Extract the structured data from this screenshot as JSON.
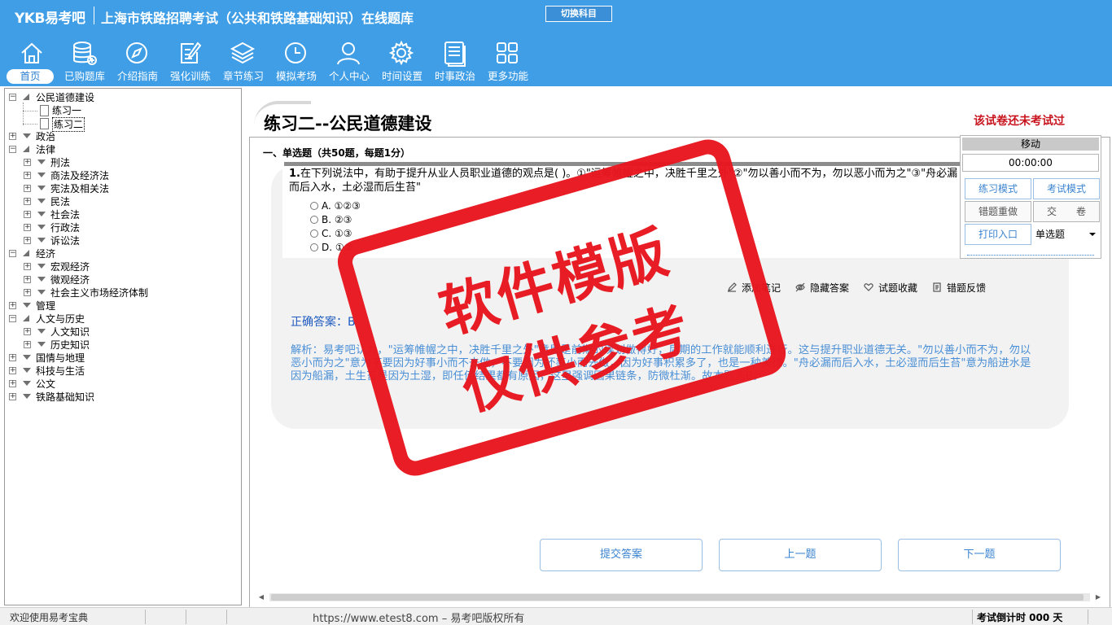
{
  "header": {
    "brand": "YKB易考吧",
    "title": "上海市铁路招聘考试（公共和铁路基础知识）在线题库",
    "switch_subject": "切换科目",
    "nav": [
      {
        "label": "首页",
        "icon": "home-icon"
      },
      {
        "label": "已购题库",
        "icon": "database-icon"
      },
      {
        "label": "介绍指南",
        "icon": "compass-icon"
      },
      {
        "label": "强化训练",
        "icon": "edit-icon"
      },
      {
        "label": "章节练习",
        "icon": "layers-icon"
      },
      {
        "label": "模拟考场",
        "icon": "clock-icon"
      },
      {
        "label": "个人中心",
        "icon": "user-icon"
      },
      {
        "label": "时间设置",
        "icon": "gear-icon"
      },
      {
        "label": "时事政治",
        "icon": "news-icon"
      },
      {
        "label": "更多功能",
        "icon": "grid-icon"
      }
    ]
  },
  "tree": [
    {
      "label": "公民道德建设",
      "level": 0,
      "state": "expanded"
    },
    {
      "label": "练习一",
      "level": 1,
      "state": "leaf"
    },
    {
      "label": "练习二",
      "level": 1,
      "state": "leaf-selected"
    },
    {
      "label": "政治",
      "level": 0,
      "state": "collapsed"
    },
    {
      "label": "法律",
      "level": 0,
      "state": "expanded"
    },
    {
      "label": "刑法",
      "level": 1,
      "state": "collapsed"
    },
    {
      "label": "商法及经济法",
      "level": 1,
      "state": "collapsed"
    },
    {
      "label": "宪法及相关法",
      "level": 1,
      "state": "collapsed"
    },
    {
      "label": "民法",
      "level": 1,
      "state": "collapsed"
    },
    {
      "label": "社会法",
      "level": 1,
      "state": "collapsed"
    },
    {
      "label": "行政法",
      "level": 1,
      "state": "collapsed"
    },
    {
      "label": "诉讼法",
      "level": 1,
      "state": "collapsed"
    },
    {
      "label": "经济",
      "level": 0,
      "state": "expanded"
    },
    {
      "label": "宏观经济",
      "level": 1,
      "state": "collapsed"
    },
    {
      "label": "微观经济",
      "level": 1,
      "state": "collapsed"
    },
    {
      "label": "社会主义市场经济体制",
      "level": 1,
      "state": "collapsed"
    },
    {
      "label": "管理",
      "level": 0,
      "state": "collapsed"
    },
    {
      "label": "人文与历史",
      "level": 0,
      "state": "expanded"
    },
    {
      "label": "人文知识",
      "level": 1,
      "state": "collapsed"
    },
    {
      "label": "历史知识",
      "level": 1,
      "state": "collapsed"
    },
    {
      "label": "国情与地理",
      "level": 0,
      "state": "collapsed"
    },
    {
      "label": "科技与生活",
      "level": 0,
      "state": "collapsed"
    },
    {
      "label": "公文",
      "level": 0,
      "state": "collapsed"
    },
    {
      "label": "铁路基础知识",
      "level": 0,
      "state": "collapsed"
    }
  ],
  "main": {
    "paper_title": "练习二--公民道德建设",
    "exam_status": "该试卷还未考试过",
    "section_title": "一、单选题（共50题，每题1分）",
    "question": {
      "number": "1.",
      "text": "在下列说法中，有助于提升从业人员职业道德的观点是(   )。①\"运筹帷幄之中，决胜千里之外\"②\"勿以善小而不为，勿以恶小而为之\"③\"舟必漏而后入水，土必湿而后生苔\"",
      "options": [
        "A. ①②③",
        "B. ②③",
        "C. ①③",
        "D. ①②"
      ]
    },
    "tools": [
      {
        "label": "添加笔记",
        "icon": "pencil-icon"
      },
      {
        "label": "隐藏答案",
        "icon": "eye-icon"
      },
      {
        "label": "试题收藏",
        "icon": "heart-icon"
      },
      {
        "label": "错题反馈",
        "icon": "feedback-icon"
      }
    ],
    "answer_label": "正确答案：B",
    "analysis": "解析：易考吧认为，\"运筹帷幄之中，决胜千里之外\"意思是前期的谋划做得好，后期的工作就能顺利进行。这与提升职业道德无关。\"勿以善小而不为，勿以恶小而为之\"意为不要因为好事小而不去做，不要因为坏事小而去做，因为好事积累多了，也是一种美德。\"舟必漏而后入水，土必湿而后生苔\"意为船进水是因为船漏，土生苔是因为土湿，即任何结果都有原因，这里强调因果链条，防微杜渐。故本题选B。",
    "buttons": {
      "submit": "提交答案",
      "prev": "上一题",
      "next": "下一题"
    }
  },
  "float_panel": {
    "move": "移动",
    "timer": "00:00:00",
    "practice_mode": "练习模式",
    "exam_mode": "考试模式",
    "redo_wrong": "错题重做",
    "submit_paper": "交　　卷",
    "print": "打印入口",
    "type_select": "单选题"
  },
  "watermark": {
    "line1": "软件模版",
    "line2": "仅供参考"
  },
  "statusbar": {
    "welcome": "欢迎使用易考宝典",
    "copyright": "https://www.etest8.com – 易考吧版权所有",
    "countdown": "考试倒计时 000 天"
  },
  "colors": {
    "header_bg": "#3f9ee6",
    "accent": "#3b84d0",
    "status_red": "#c8141e",
    "stamp_red": "#e8161e"
  }
}
